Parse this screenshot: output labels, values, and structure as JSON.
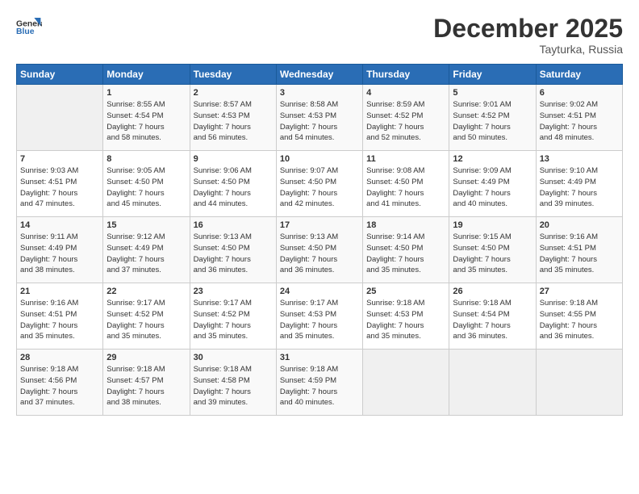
{
  "header": {
    "logo_line1": "General",
    "logo_line2": "Blue",
    "month": "December 2025",
    "location": "Tayturka, Russia"
  },
  "days_header": [
    "Sunday",
    "Monday",
    "Tuesday",
    "Wednesday",
    "Thursday",
    "Friday",
    "Saturday"
  ],
  "weeks": [
    [
      {
        "day": "",
        "content": ""
      },
      {
        "day": "1",
        "content": "Sunrise: 8:55 AM\nSunset: 4:54 PM\nDaylight: 7 hours\nand 58 minutes."
      },
      {
        "day": "2",
        "content": "Sunrise: 8:57 AM\nSunset: 4:53 PM\nDaylight: 7 hours\nand 56 minutes."
      },
      {
        "day": "3",
        "content": "Sunrise: 8:58 AM\nSunset: 4:53 PM\nDaylight: 7 hours\nand 54 minutes."
      },
      {
        "day": "4",
        "content": "Sunrise: 8:59 AM\nSunset: 4:52 PM\nDaylight: 7 hours\nand 52 minutes."
      },
      {
        "day": "5",
        "content": "Sunrise: 9:01 AM\nSunset: 4:52 PM\nDaylight: 7 hours\nand 50 minutes."
      },
      {
        "day": "6",
        "content": "Sunrise: 9:02 AM\nSunset: 4:51 PM\nDaylight: 7 hours\nand 48 minutes."
      }
    ],
    [
      {
        "day": "7",
        "content": "Sunrise: 9:03 AM\nSunset: 4:51 PM\nDaylight: 7 hours\nand 47 minutes."
      },
      {
        "day": "8",
        "content": "Sunrise: 9:05 AM\nSunset: 4:50 PM\nDaylight: 7 hours\nand 45 minutes."
      },
      {
        "day": "9",
        "content": "Sunrise: 9:06 AM\nSunset: 4:50 PM\nDaylight: 7 hours\nand 44 minutes."
      },
      {
        "day": "10",
        "content": "Sunrise: 9:07 AM\nSunset: 4:50 PM\nDaylight: 7 hours\nand 42 minutes."
      },
      {
        "day": "11",
        "content": "Sunrise: 9:08 AM\nSunset: 4:50 PM\nDaylight: 7 hours\nand 41 minutes."
      },
      {
        "day": "12",
        "content": "Sunrise: 9:09 AM\nSunset: 4:49 PM\nDaylight: 7 hours\nand 40 minutes."
      },
      {
        "day": "13",
        "content": "Sunrise: 9:10 AM\nSunset: 4:49 PM\nDaylight: 7 hours\nand 39 minutes."
      }
    ],
    [
      {
        "day": "14",
        "content": "Sunrise: 9:11 AM\nSunset: 4:49 PM\nDaylight: 7 hours\nand 38 minutes."
      },
      {
        "day": "15",
        "content": "Sunrise: 9:12 AM\nSunset: 4:49 PM\nDaylight: 7 hours\nand 37 minutes."
      },
      {
        "day": "16",
        "content": "Sunrise: 9:13 AM\nSunset: 4:50 PM\nDaylight: 7 hours\nand 36 minutes."
      },
      {
        "day": "17",
        "content": "Sunrise: 9:13 AM\nSunset: 4:50 PM\nDaylight: 7 hours\nand 36 minutes."
      },
      {
        "day": "18",
        "content": "Sunrise: 9:14 AM\nSunset: 4:50 PM\nDaylight: 7 hours\nand 35 minutes."
      },
      {
        "day": "19",
        "content": "Sunrise: 9:15 AM\nSunset: 4:50 PM\nDaylight: 7 hours\nand 35 minutes."
      },
      {
        "day": "20",
        "content": "Sunrise: 9:16 AM\nSunset: 4:51 PM\nDaylight: 7 hours\nand 35 minutes."
      }
    ],
    [
      {
        "day": "21",
        "content": "Sunrise: 9:16 AM\nSunset: 4:51 PM\nDaylight: 7 hours\nand 35 minutes."
      },
      {
        "day": "22",
        "content": "Sunrise: 9:17 AM\nSunset: 4:52 PM\nDaylight: 7 hours\nand 35 minutes."
      },
      {
        "day": "23",
        "content": "Sunrise: 9:17 AM\nSunset: 4:52 PM\nDaylight: 7 hours\nand 35 minutes."
      },
      {
        "day": "24",
        "content": "Sunrise: 9:17 AM\nSunset: 4:53 PM\nDaylight: 7 hours\nand 35 minutes."
      },
      {
        "day": "25",
        "content": "Sunrise: 9:18 AM\nSunset: 4:53 PM\nDaylight: 7 hours\nand 35 minutes."
      },
      {
        "day": "26",
        "content": "Sunrise: 9:18 AM\nSunset: 4:54 PM\nDaylight: 7 hours\nand 36 minutes."
      },
      {
        "day": "27",
        "content": "Sunrise: 9:18 AM\nSunset: 4:55 PM\nDaylight: 7 hours\nand 36 minutes."
      }
    ],
    [
      {
        "day": "28",
        "content": "Sunrise: 9:18 AM\nSunset: 4:56 PM\nDaylight: 7 hours\nand 37 minutes."
      },
      {
        "day": "29",
        "content": "Sunrise: 9:18 AM\nSunset: 4:57 PM\nDaylight: 7 hours\nand 38 minutes."
      },
      {
        "day": "30",
        "content": "Sunrise: 9:18 AM\nSunset: 4:58 PM\nDaylight: 7 hours\nand 39 minutes."
      },
      {
        "day": "31",
        "content": "Sunrise: 9:18 AM\nSunset: 4:59 PM\nDaylight: 7 hours\nand 40 minutes."
      },
      {
        "day": "",
        "content": ""
      },
      {
        "day": "",
        "content": ""
      },
      {
        "day": "",
        "content": ""
      }
    ]
  ]
}
